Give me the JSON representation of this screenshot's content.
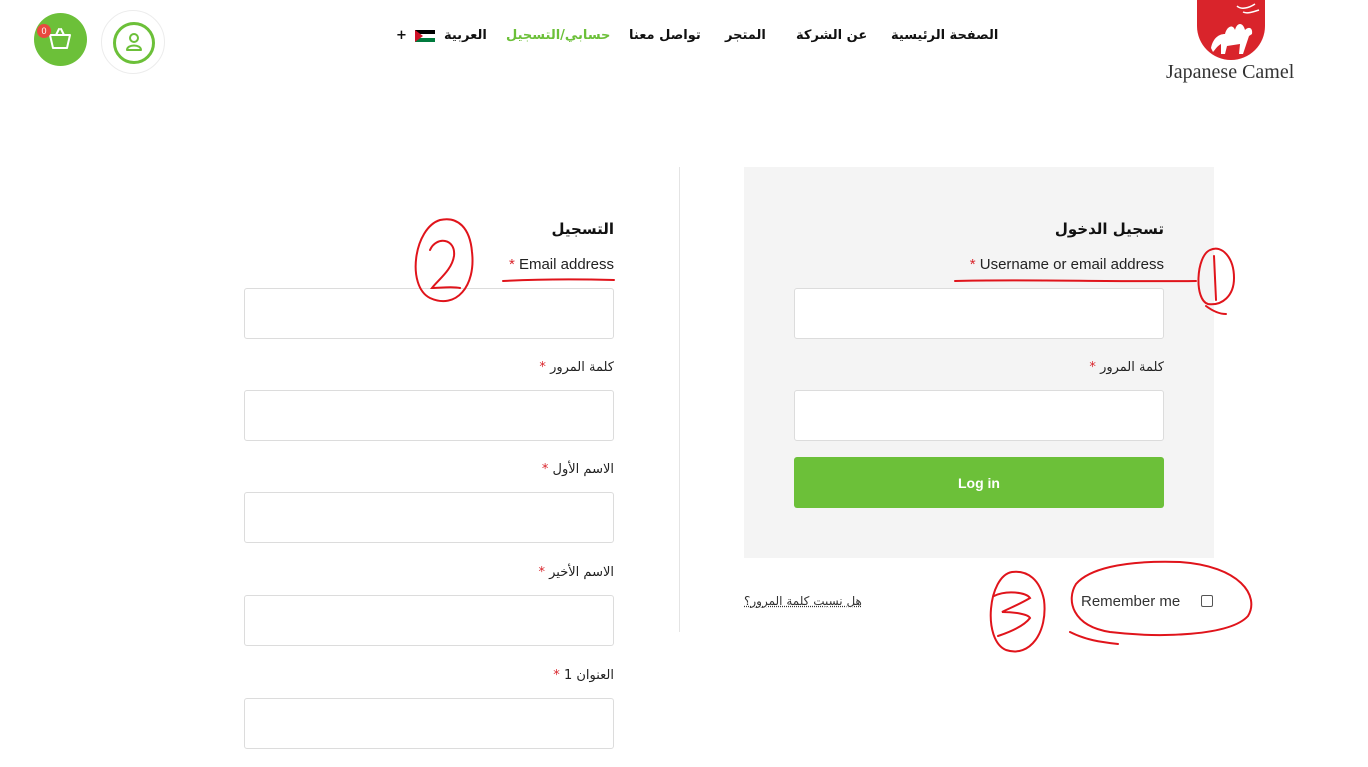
{
  "header": {
    "cart_count": "0",
    "nav": {
      "home": "الصفحة الرئيسية",
      "about": "عن الشركة",
      "shop": "المتجر",
      "contact": "تواصل معنا",
      "account": "حسابي/التسجيل",
      "language": "العربية",
      "language_plus": "+"
    },
    "logo_text": "Japanese Camel",
    "accent_color": "#6cc039",
    "logo_color": "#d9242b"
  },
  "login": {
    "heading": "تسجيل الدخول",
    "username_label": "Username or email address",
    "password_label": "كلمة المرور",
    "required_mark": "*",
    "button": "Log in",
    "remember_label": "Remember me",
    "lost_password": "هل نسيت كلمة المرور؟"
  },
  "register": {
    "heading": "التسجيل",
    "email_label": "Email address",
    "password_label": "كلمة المرور",
    "first_name_label": "الاسم الأول",
    "last_name_label": "الاسم الأخير",
    "address_label": "العنوان 1"
  },
  "annotations": {
    "numbers": [
      "1",
      "2",
      "3"
    ],
    "color": "#e0141b"
  },
  "icons": [
    "cart-icon",
    "user-icon",
    "jordan-flag-icon",
    "camel-logo-icon",
    "checkbox-icon"
  ]
}
